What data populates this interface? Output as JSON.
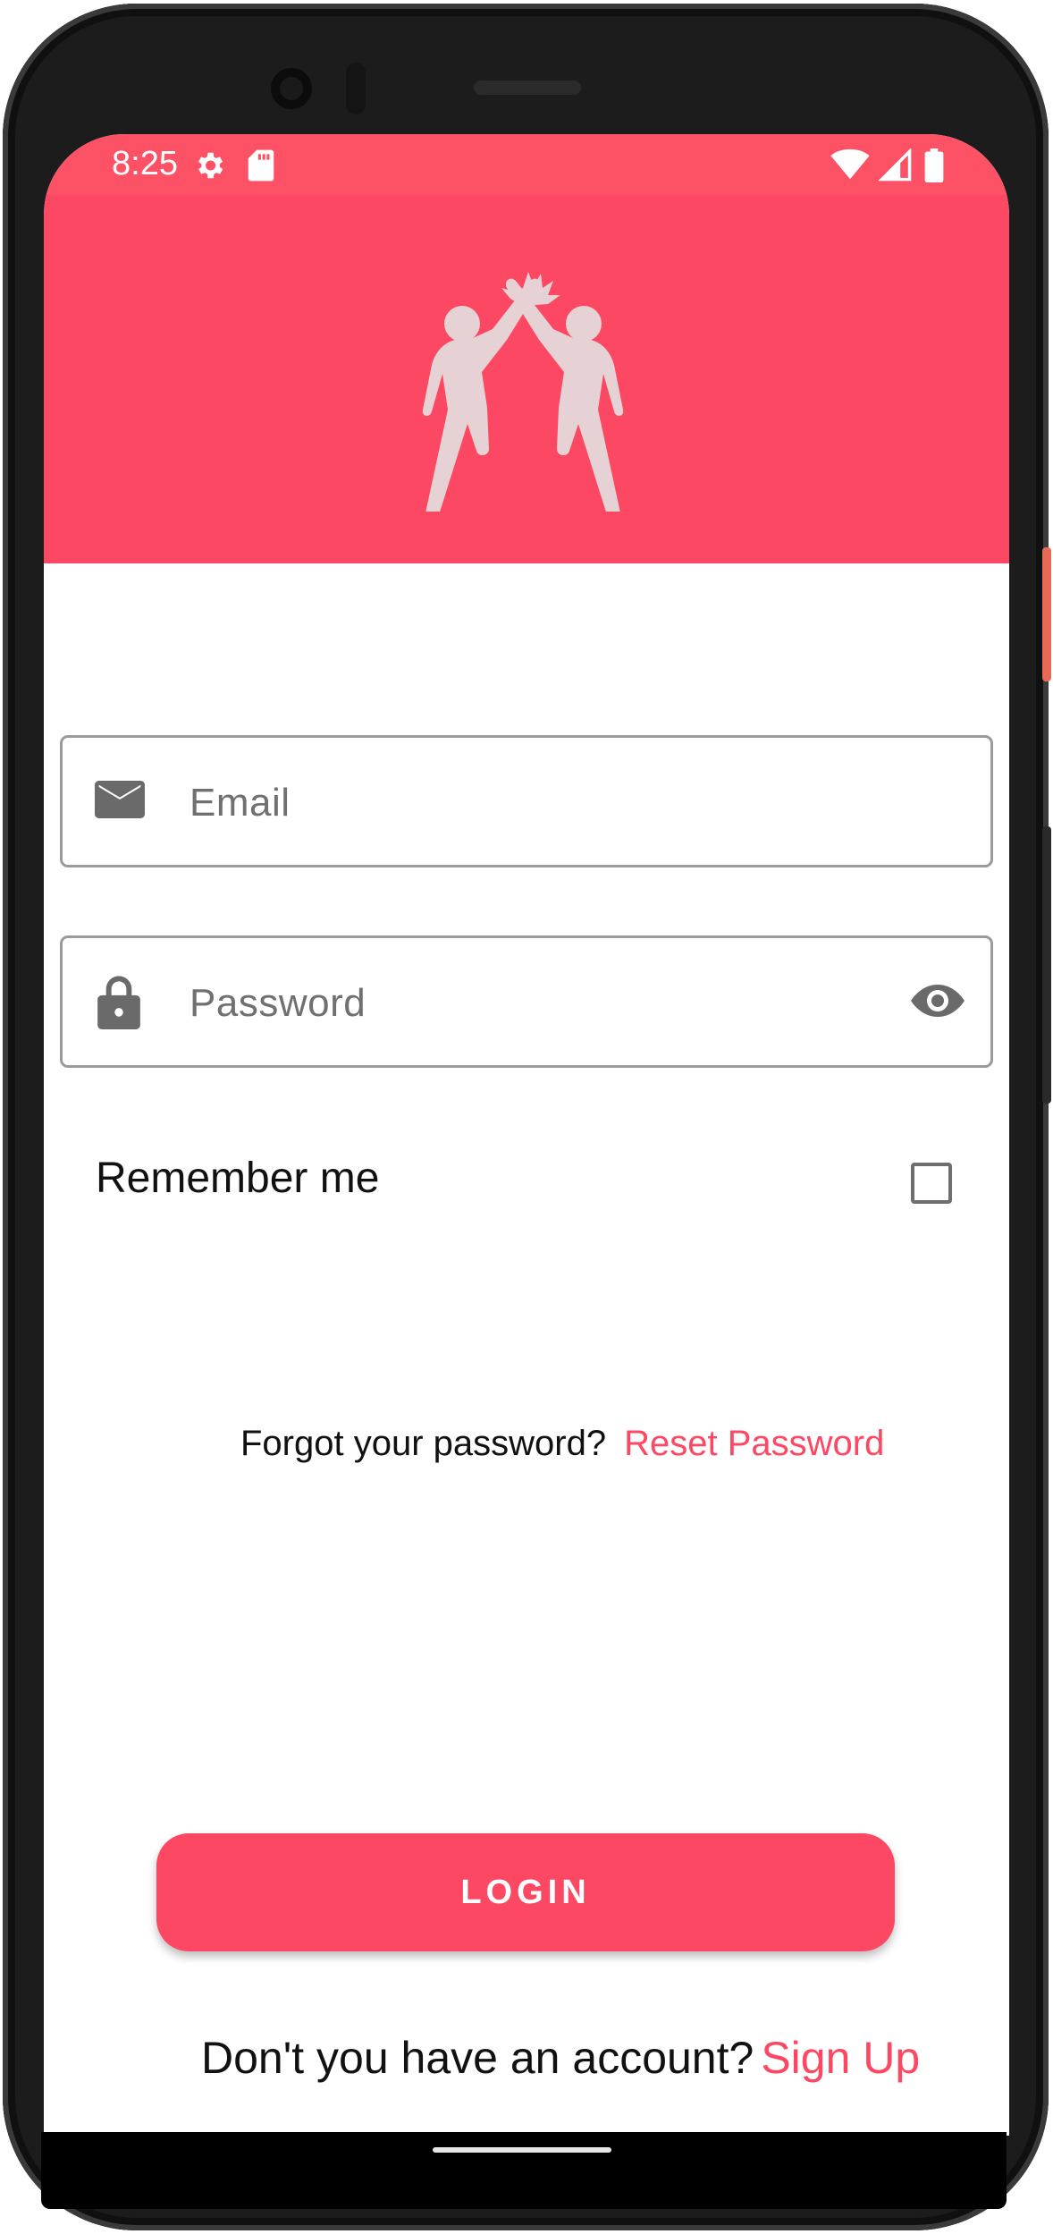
{
  "status_bar": {
    "time": "8:25",
    "left_icons": [
      "gear-icon",
      "sd-card-icon"
    ],
    "right_icons": [
      "wifi-icon",
      "signal-icon",
      "battery-icon"
    ],
    "color": "#fd5266"
  },
  "header": {
    "color": "#fc4862",
    "logo_icon": "high-five-logo"
  },
  "email_field": {
    "placeholder": "Email",
    "value": "",
    "icon": "mail-icon"
  },
  "password_field": {
    "placeholder": "Password",
    "value": "",
    "icon": "lock-icon",
    "toggle_icon": "eye-icon"
  },
  "remember_me": {
    "label": "Remember me",
    "checked": false
  },
  "forgot": {
    "prompt": "Forgot your password?",
    "link": "Reset Password"
  },
  "login_button": {
    "label": "LOGIN"
  },
  "signup": {
    "prompt": "Don't you have an account?",
    "link": "Sign Up"
  },
  "colors": {
    "accent": "#fc4862",
    "text": "#111111",
    "placeholder": "#707070"
  }
}
